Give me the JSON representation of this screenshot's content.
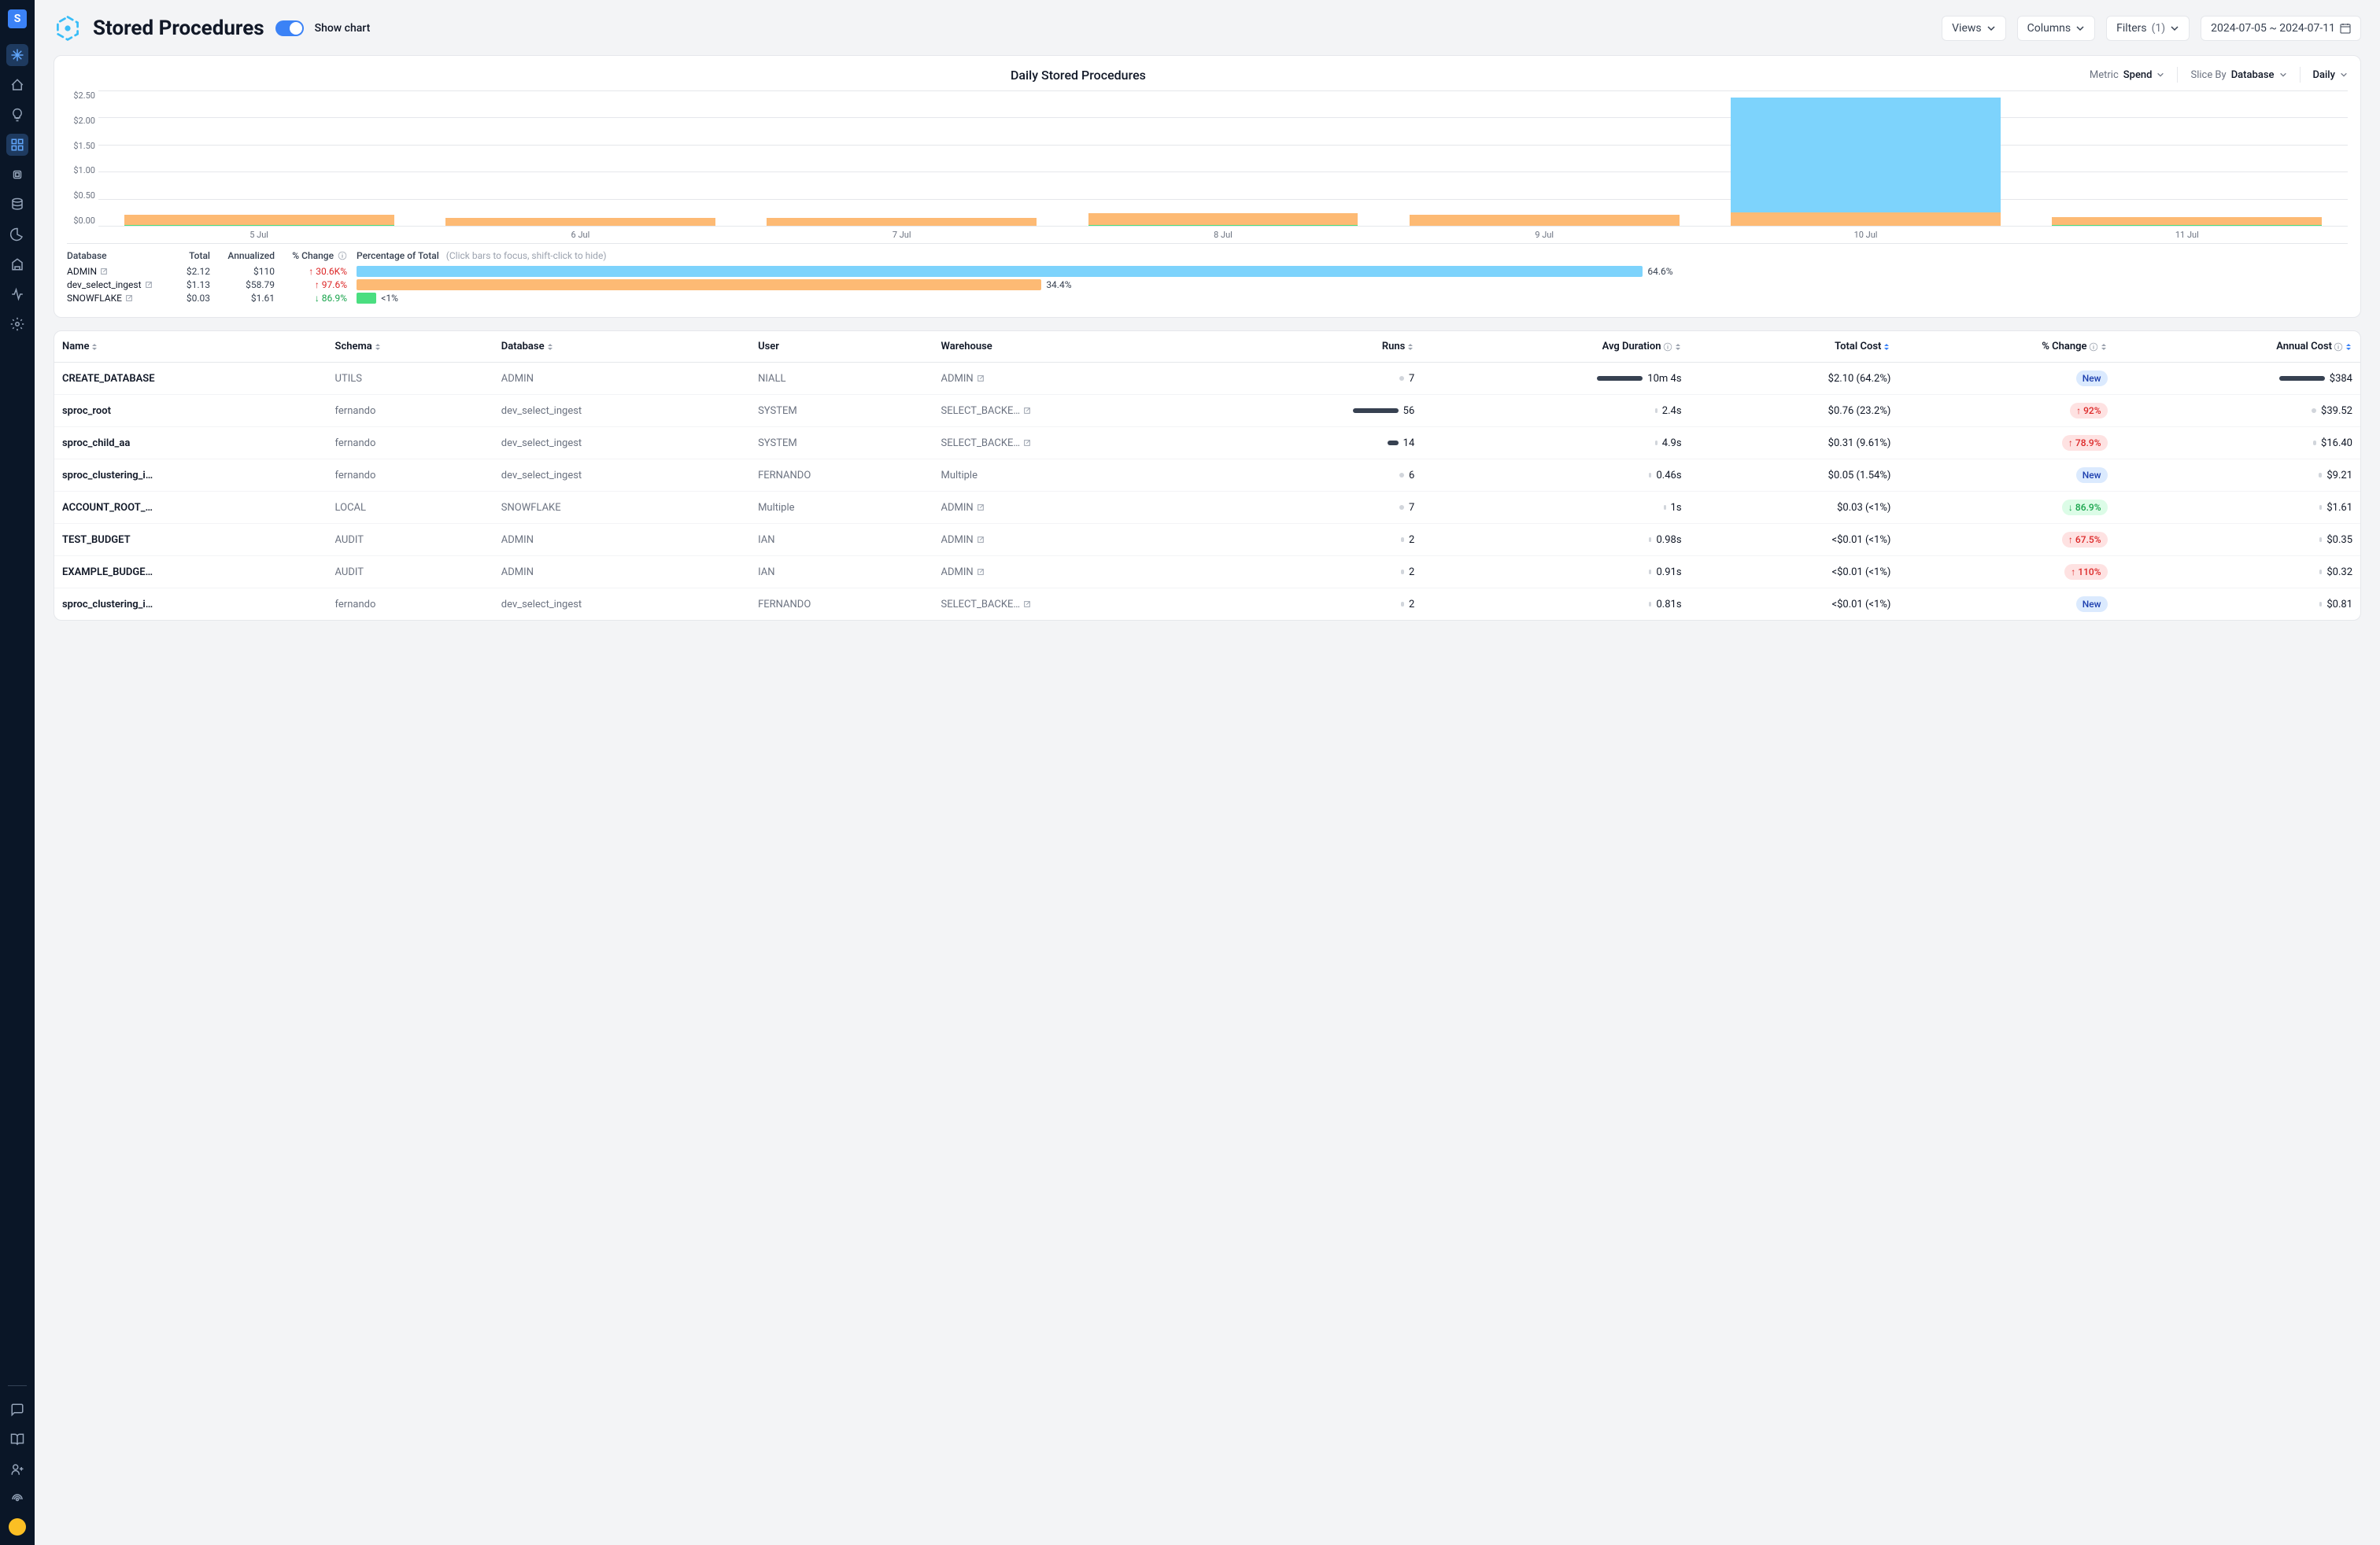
{
  "page": {
    "title": "Stored Procedures",
    "show_chart_label": "Show chart"
  },
  "toolbar": {
    "views": "Views",
    "columns": "Columns",
    "filters": "Filters",
    "filters_count": "(1)",
    "date_range": "2024-07-05 ~ 2024-07-11"
  },
  "chart": {
    "title": "Daily Stored Procedures",
    "metric_label": "Metric",
    "metric_value": "Spend",
    "slice_label": "Slice By",
    "slice_value": "Database",
    "interval_value": "Daily"
  },
  "chart_data": {
    "type": "bar",
    "title": "Daily Stored Procedures",
    "xlabel": "",
    "ylabel": "",
    "ylim": [
      0,
      2.5
    ],
    "y_ticks": [
      "$2.50",
      "$2.00",
      "$1.50",
      "$1.00",
      "$0.50",
      "$0.00"
    ],
    "categories": [
      "5 Jul",
      "6 Jul",
      "7 Jul",
      "8 Jul",
      "9 Jul",
      "10 Jul",
      "11 Jul"
    ],
    "series": [
      {
        "name": "ADMIN",
        "color": "#7dd3fc",
        "values": [
          0.0,
          0.0,
          0.0,
          0.0,
          0.0,
          2.12,
          0.0
        ]
      },
      {
        "name": "dev_select_ingest",
        "color": "#fdba74",
        "values": [
          0.2,
          0.14,
          0.14,
          0.23,
          0.21,
          0.25,
          0.15
        ]
      },
      {
        "name": "SNOWFLAKE",
        "color": "#4ade80",
        "values": [
          0.01,
          0.0,
          0.0,
          0.01,
          0.0,
          0.0,
          0.01
        ]
      }
    ]
  },
  "breakdown": {
    "headers": {
      "database": "Database",
      "total": "Total",
      "annualized": "Annualized",
      "change": "% Change",
      "pct_total": "Percentage of Total",
      "hint": "(Click bars to focus, shift-click to hide)"
    },
    "rows": [
      {
        "database": "ADMIN",
        "total": "$2.12",
        "annualized": "$110",
        "change": "30.6K%",
        "dir": "up",
        "pct": 64.6,
        "pct_label": "64.6%",
        "color": "#7dd3fc"
      },
      {
        "database": "dev_select_ingest",
        "total": "$1.13",
        "annualized": "$58.79",
        "change": "97.6%",
        "dir": "up",
        "pct": 34.4,
        "pct_label": "34.4%",
        "color": "#fdba74"
      },
      {
        "database": "SNOWFLAKE",
        "total": "$0.03",
        "annualized": "$1.61",
        "change": "86.9%",
        "dir": "down",
        "pct": 1.0,
        "pct_label": "<1%",
        "color": "#4ade80"
      }
    ]
  },
  "table": {
    "columns": {
      "name": "Name",
      "schema": "Schema",
      "database": "Database",
      "user": "User",
      "warehouse": "Warehouse",
      "runs": "Runs",
      "avg_duration": "Avg Duration",
      "total_cost": "Total Cost",
      "pct_change": "% Change",
      "annual_cost": "Annual Cost"
    },
    "rows": [
      {
        "name": "CREATE_DATABASE",
        "schema": "UTILS",
        "database": "ADMIN",
        "user": "NIALL",
        "warehouse": "ADMIN",
        "wh_ext": true,
        "runs": "7",
        "runs_bar": 6,
        "avg_duration": "10m 4s",
        "dur_bar": 58,
        "total_cost": "$2.10 (64.2%)",
        "pct_change": "New",
        "pct_kind": "new",
        "annual_cost": "$384",
        "annual_bar": 58
      },
      {
        "name": "sproc_root",
        "schema": "fernando",
        "database": "dev_select_ingest",
        "user": "SYSTEM",
        "warehouse": "SELECT_BACKE…",
        "wh_ext": true,
        "runs": "56",
        "runs_bar": 58,
        "avg_duration": "2.4s",
        "dur_bar": 3,
        "total_cost": "$0.76 (23.2%)",
        "pct_change": "92%",
        "pct_kind": "up",
        "annual_cost": "$39.52",
        "annual_bar": 6
      },
      {
        "name": "sproc_child_aa",
        "schema": "fernando",
        "database": "dev_select_ingest",
        "user": "SYSTEM",
        "warehouse": "SELECT_BACKE…",
        "wh_ext": true,
        "runs": "14",
        "runs_bar": 14,
        "avg_duration": "4.9s",
        "dur_bar": 3,
        "total_cost": "$0.31 (9.61%)",
        "pct_change": "78.9%",
        "pct_kind": "up",
        "annual_cost": "$16.40",
        "annual_bar": 4
      },
      {
        "name": "sproc_clustering_i…",
        "schema": "fernando",
        "database": "dev_select_ingest",
        "user": "FERNANDO",
        "warehouse": "Multiple",
        "wh_ext": false,
        "runs": "6",
        "runs_bar": 6,
        "avg_duration": "0.46s",
        "dur_bar": 3,
        "total_cost": "$0.05 (1.54%)",
        "pct_change": "New",
        "pct_kind": "new",
        "annual_cost": "$9.21",
        "annual_bar": 4
      },
      {
        "name": "ACCOUNT_ROOT_…",
        "schema": "LOCAL",
        "database": "SNOWFLAKE",
        "user": "Multiple",
        "warehouse": "ADMIN",
        "wh_ext": true,
        "runs": "7",
        "runs_bar": 6,
        "avg_duration": "1s",
        "dur_bar": 3,
        "total_cost": "$0.03 (<1%)",
        "pct_change": "86.9%",
        "pct_kind": "down",
        "annual_cost": "$1.61",
        "annual_bar": 3
      },
      {
        "name": "TEST_BUDGET",
        "schema": "AUDIT",
        "database": "ADMIN",
        "user": "IAN",
        "warehouse": "ADMIN",
        "wh_ext": true,
        "runs": "2",
        "runs_bar": 4,
        "avg_duration": "0.98s",
        "dur_bar": 3,
        "total_cost": "<$0.01 (<1%)",
        "pct_change": "67.5%",
        "pct_kind": "up",
        "annual_cost": "$0.35",
        "annual_bar": 3
      },
      {
        "name": "EXAMPLE_BUDGE…",
        "schema": "AUDIT",
        "database": "ADMIN",
        "user": "IAN",
        "warehouse": "ADMIN",
        "wh_ext": true,
        "runs": "2",
        "runs_bar": 4,
        "avg_duration": "0.91s",
        "dur_bar": 3,
        "total_cost": "<$0.01 (<1%)",
        "pct_change": "110%",
        "pct_kind": "up",
        "annual_cost": "$0.32",
        "annual_bar": 3
      },
      {
        "name": "sproc_clustering_i…",
        "schema": "fernando",
        "database": "dev_select_ingest",
        "user": "FERNANDO",
        "warehouse": "SELECT_BACKE…",
        "wh_ext": true,
        "runs": "2",
        "runs_bar": 4,
        "avg_duration": "0.81s",
        "dur_bar": 3,
        "total_cost": "<$0.01 (<1%)",
        "pct_change": "New",
        "pct_kind": "new",
        "annual_cost": "$0.81",
        "annual_bar": 3
      }
    ]
  }
}
